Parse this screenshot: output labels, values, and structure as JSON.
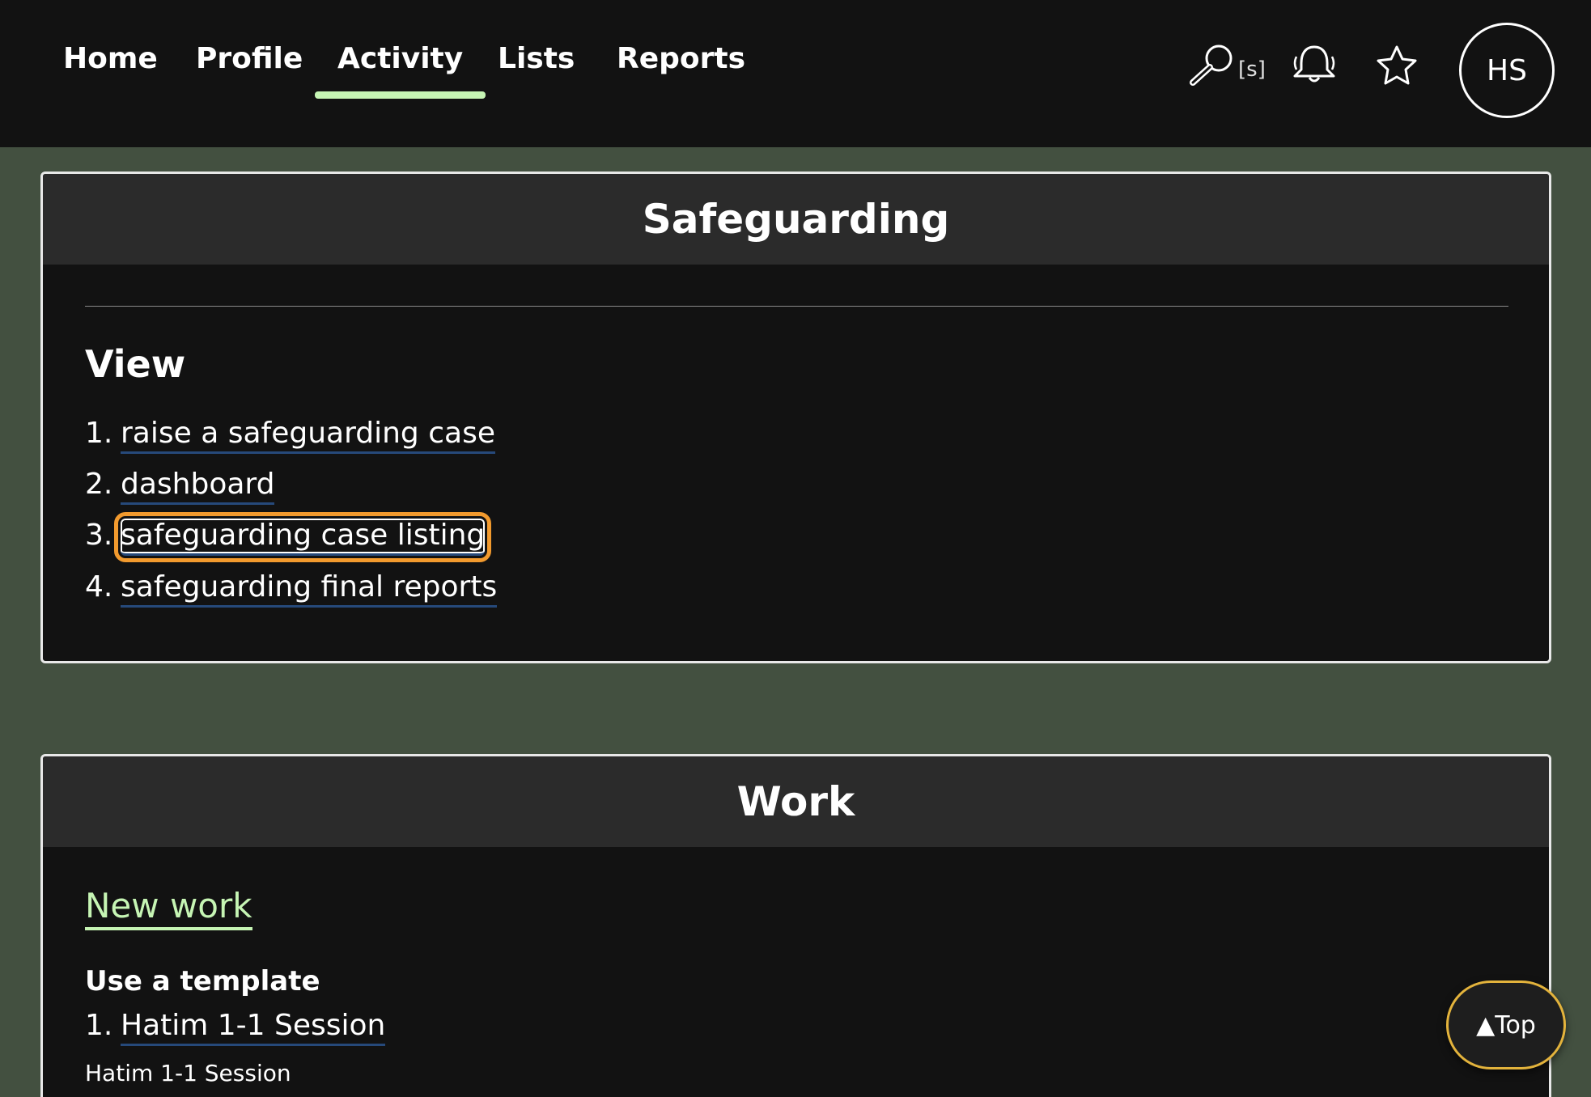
{
  "nav": {
    "tabs": [
      {
        "label": "Home"
      },
      {
        "label": "Profile"
      },
      {
        "label": "Activity",
        "active": true
      },
      {
        "label": "Lists"
      },
      {
        "label": "Reports"
      }
    ],
    "search_hint": "[s]",
    "icons": [
      "search-icon",
      "bell-icon",
      "star-icon"
    ],
    "avatar_initials": "HS"
  },
  "safeguarding": {
    "title": "Safeguarding",
    "view_heading": "View",
    "items": [
      {
        "num": "1.",
        "label": "raise a safeguarding case"
      },
      {
        "num": "2.",
        "label": "dashboard"
      },
      {
        "num": "3.",
        "label": "safeguarding case listing",
        "focused": true
      },
      {
        "num": "4.",
        "label": "safeguarding final reports"
      }
    ]
  },
  "work": {
    "title": "Work",
    "new_work": "New work",
    "template_heading": "Use a template",
    "templates": [
      {
        "num": "1.",
        "label": "Hatim 1-1 Session"
      }
    ],
    "template_description": "Hatim 1-1 Session"
  },
  "top_button": "▲Top",
  "colors": {
    "background": "#435040",
    "header": "#121212",
    "accent": "#c6f5b4",
    "focus": "#f29a2e",
    "link_underline": "#26497a"
  }
}
